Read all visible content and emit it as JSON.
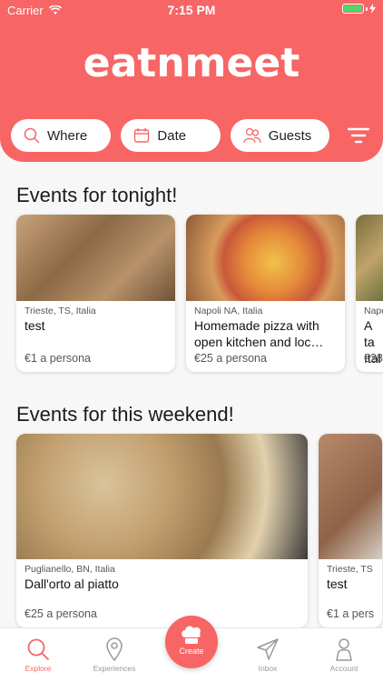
{
  "status": {
    "carrier": "Carrier",
    "time": "7:15 PM"
  },
  "header": {
    "logo": "eatnmeet"
  },
  "filters": {
    "where": "Where",
    "date": "Date",
    "guests": "Guests"
  },
  "sections": [
    {
      "title": "Events for tonight!",
      "cards": [
        {
          "location": "Trieste, TS, Italia",
          "title": "test",
          "price": "€1 a persona"
        },
        {
          "location": "Napoli NA, Italia",
          "title": "Homemade pizza with open kitchen and loc…",
          "price": "€25 a persona"
        },
        {
          "location": "Napo",
          "title": "A ta Ital",
          "price": "€28"
        }
      ]
    },
    {
      "title": "Events for this weekend!",
      "cards": [
        {
          "location": "Puglianello, BN, Italia",
          "title": "Dall'orto al piatto",
          "price": "€25 a persona"
        },
        {
          "location": "Trieste, TS",
          "title": "test",
          "price": "€1 a pers"
        }
      ]
    }
  ],
  "tabbar": {
    "explore": "Explore",
    "experiences": "Experiences",
    "create": "Create",
    "inbox": "Inbox",
    "account": "Account"
  },
  "colors": {
    "accent": "#f76565",
    "battery": "#4cd964"
  }
}
